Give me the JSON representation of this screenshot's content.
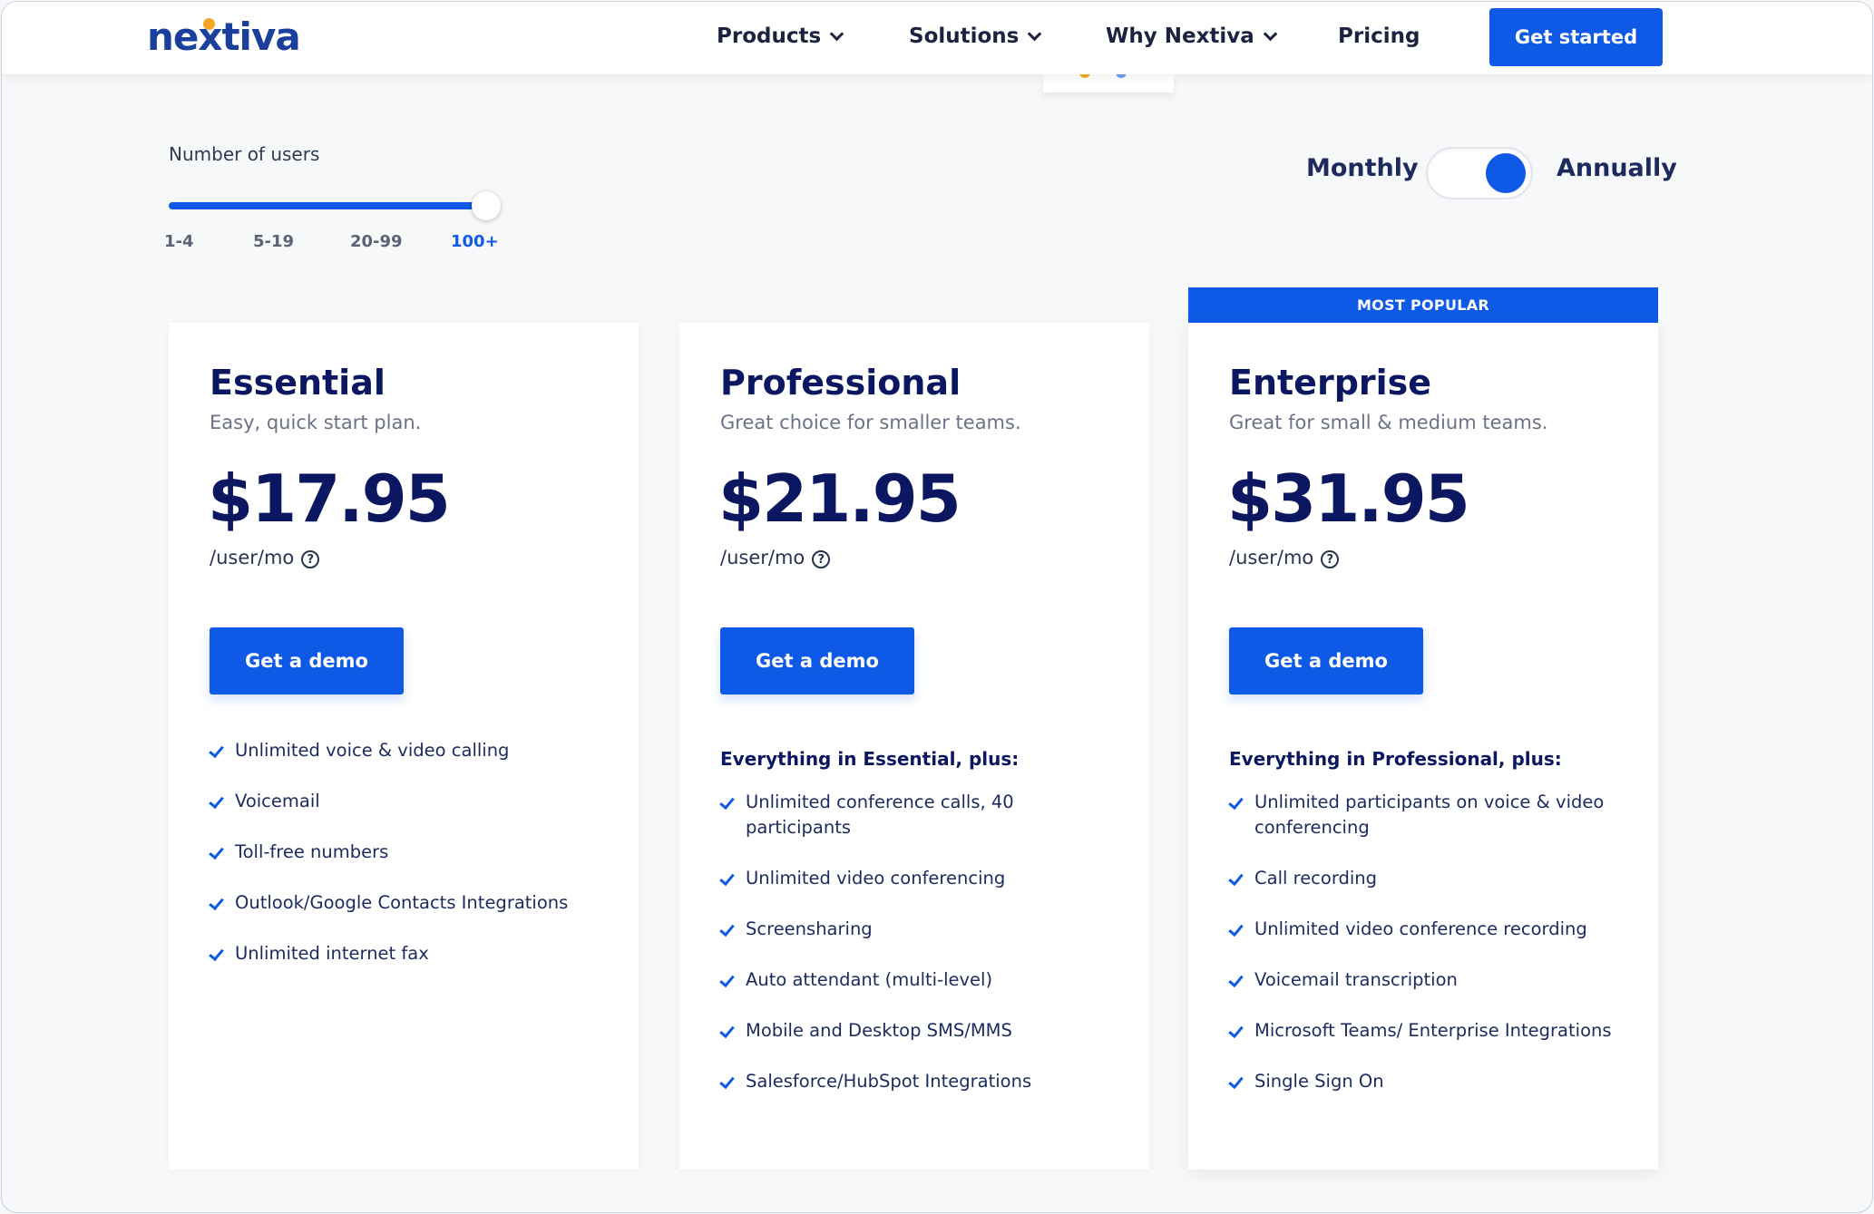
{
  "header": {
    "logo": "nextiva",
    "nav": [
      {
        "label": "Products",
        "has_dropdown": true
      },
      {
        "label": "Solutions",
        "has_dropdown": true
      },
      {
        "label": "Why Nextiva",
        "has_dropdown": true
      },
      {
        "label": "Pricing",
        "has_dropdown": false
      }
    ],
    "cta": "Get started"
  },
  "users": {
    "label": "Number of users",
    "ticks": [
      "1-4",
      "5-19",
      "20-99",
      "100+"
    ],
    "selected": "100+",
    "selected_fraction": 1.0
  },
  "billing": {
    "monthly": "Monthly",
    "annually": "Annually",
    "selected": "Annually"
  },
  "plans": [
    {
      "name": "Essential",
      "desc": "Easy, quick start plan.",
      "price": "$17.95",
      "unit": "/user/mo",
      "button": "Get a demo",
      "plus_heading": "",
      "features": [
        "Unlimited voice & video calling",
        "Voicemail",
        "Toll-free numbers",
        "Outlook/Google Contacts Integrations",
        "Unlimited internet fax"
      ]
    },
    {
      "name": "Professional",
      "desc": "Great choice for smaller teams.",
      "price": "$21.95",
      "unit": "/user/mo",
      "button": "Get a demo",
      "plus_heading": "Everything in Essential, plus:",
      "features": [
        "Unlimited conference calls, 40 participants",
        "Unlimited video conferencing",
        "Screensharing",
        "Auto attendant (multi-level)",
        "Mobile and Desktop SMS/MMS",
        "Salesforce/HubSpot Integrations"
      ]
    },
    {
      "name": "Enterprise",
      "desc": "Great for small & medium teams.",
      "price": "$31.95",
      "unit": "/user/mo",
      "button": "Get a demo",
      "badge": "MOST POPULAR",
      "plus_heading": "Everything in Professional, plus:",
      "features": [
        "Unlimited participants on voice & video conferencing",
        "Call recording",
        "Unlimited video conference recording",
        "Voicemail transcription",
        "Microsoft Teams/ Enterprise Integrations",
        "Single Sign On"
      ]
    }
  ],
  "colors": {
    "brand": "#0e5ae6",
    "navy": "#0b1760",
    "logo": "#1a3f9c",
    "logo_dot": "#f5a623"
  },
  "icons": {
    "chevron": "chevron-down-icon",
    "help": "question-circle-icon",
    "check": "check-icon"
  }
}
